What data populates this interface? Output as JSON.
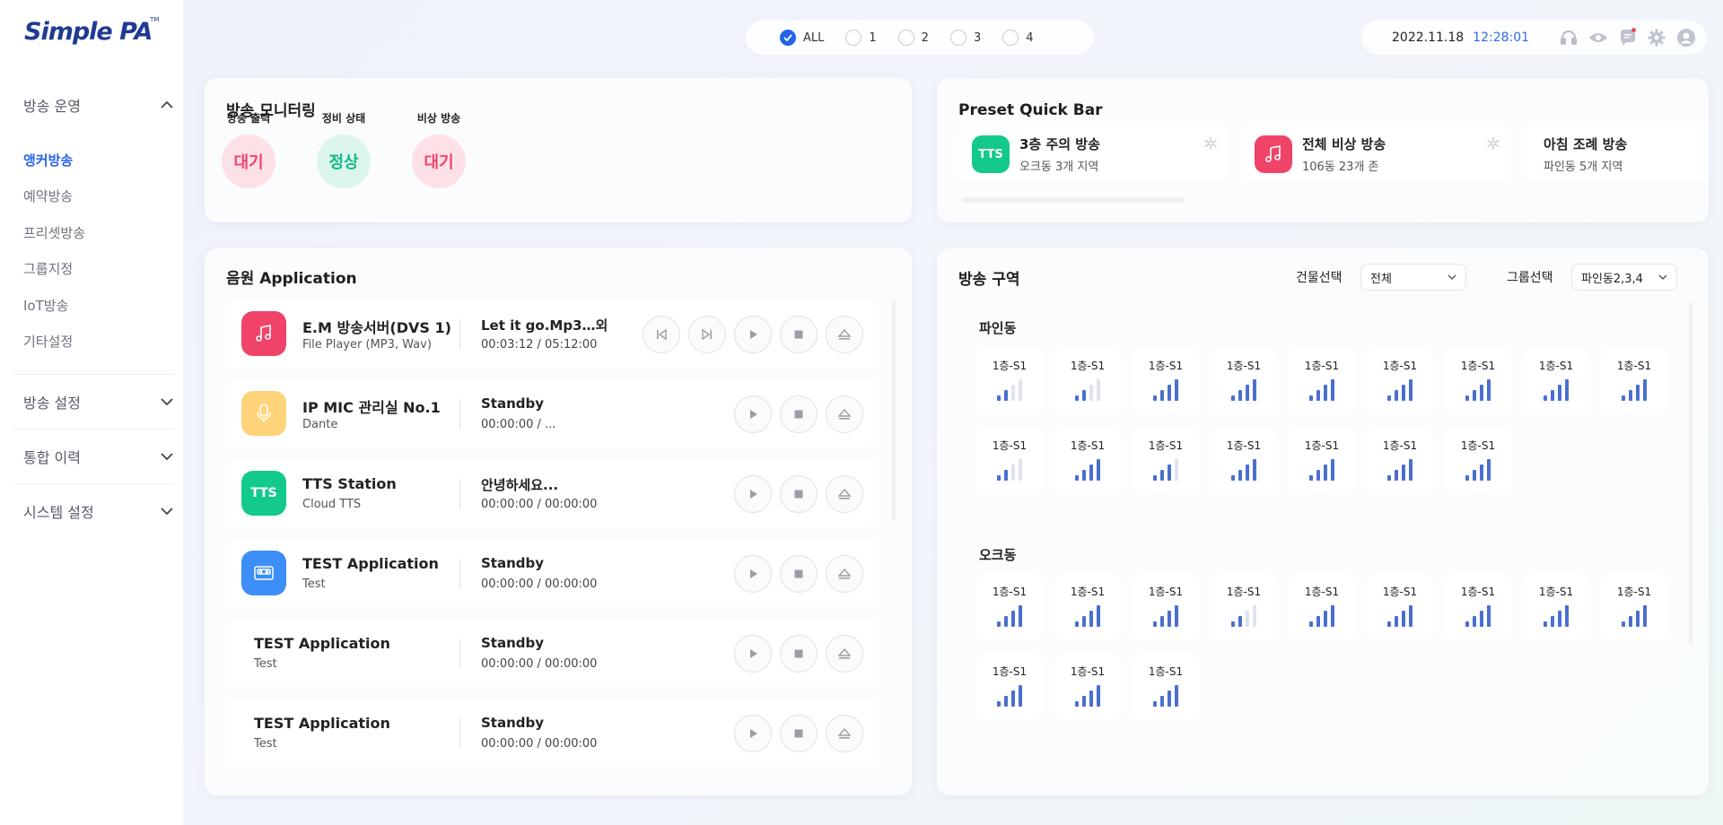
{
  "brand": {
    "logo_text": "Simple PA",
    "tm": "TM"
  },
  "sidebar": {
    "groups": [
      {
        "label": "방송 운영",
        "expanded": true,
        "items": [
          "앵커방송",
          "예약방송",
          "프리셋방송",
          "그룹지정",
          "IoT방송",
          "기타설정"
        ],
        "active_index": 0
      },
      {
        "label": "방송 설정",
        "expanded": false
      },
      {
        "label": "통합 이력",
        "expanded": false
      },
      {
        "label": "시스템 설정",
        "expanded": false
      }
    ]
  },
  "filters": {
    "options": [
      "ALL",
      "1",
      "2",
      "3",
      "4"
    ],
    "selected": "ALL"
  },
  "status": {
    "date": "2022.11.18",
    "time": "12:28:01",
    "icons": [
      "headset-icon",
      "eye-icon",
      "message-icon",
      "settings-icon",
      "user-icon"
    ]
  },
  "monitoring": {
    "title": "방송 모니터링",
    "items": [
      {
        "label": "방송 출력",
        "value": "대기",
        "color": "#f0436a",
        "bg": "#fde1e7"
      },
      {
        "label": "정비 상태",
        "value": "정상",
        "color": "#12b886",
        "bg": "#dcf6ec"
      },
      {
        "label": "비상 방송",
        "value": "대기",
        "color": "#f0436a",
        "bg": "#fde1e7"
      }
    ]
  },
  "preset": {
    "title": "Preset Quick Bar",
    "cards": [
      {
        "icon": "tts-icon",
        "icon_text": "TTS",
        "color": "#14c98c",
        "title": "3층 주의 방송",
        "sub": "오크동 3개 지역"
      },
      {
        "icon": "music-note-icon",
        "color": "#f0436a",
        "title": "전체 비상 방송",
        "sub": "106동 23개 존"
      },
      {
        "icon": "",
        "color": "",
        "title": "아침 조례 방송",
        "sub": "파인동 5개 지역"
      }
    ]
  },
  "audio": {
    "title": "음원 Application",
    "rows": [
      {
        "icon": "music-note-icon",
        "color": "#f0436a",
        "name": "E.M 방송서버(DVS 1)",
        "sub": "File Player (MP3, Wav)",
        "track": "Let it go.Mp3…외",
        "time": "00:03:12 / 05:12:00",
        "controls": [
          "prev",
          "next",
          "play",
          "stop",
          "eject"
        ]
      },
      {
        "icon": "microphone-icon",
        "color": "#ffd37a",
        "name": "IP MIC 관리실 No.1",
        "sub": "Dante",
        "track": "Standby",
        "time": "00:00:00 / ...",
        "controls": [
          "play",
          "stop",
          "eject"
        ]
      },
      {
        "icon": "tts-icon",
        "icon_text": "TTS",
        "color": "#14c98c",
        "name": "TTS Station",
        "sub": "Cloud TTS",
        "track": "안녕하세요...",
        "time": "00:00:00 / 00:00:00",
        "controls": [
          "play",
          "stop",
          "eject"
        ]
      },
      {
        "icon": "cassette-icon",
        "color": "#3d8ef7",
        "name": "TEST Application",
        "sub": "Test",
        "track": "Standby",
        "time": "00:00:00 / 00:00:00",
        "controls": [
          "play",
          "stop",
          "eject"
        ]
      },
      {
        "icon": "",
        "color": "",
        "name": "TEST Application",
        "sub": "Test",
        "track": "Standby",
        "time": "00:00:00 / 00:00:00",
        "controls": [
          "play",
          "stop",
          "eject"
        ]
      },
      {
        "icon": "",
        "color": "",
        "name": "TEST Application",
        "sub": "Test",
        "track": "Standby",
        "time": "00:00:00 / 00:00:00",
        "controls": [
          "play",
          "stop",
          "eject"
        ]
      }
    ]
  },
  "zones": {
    "title": "방송 구역",
    "building_label": "건물선택",
    "building_value": "전체",
    "group_label": "그룹선택",
    "group_value": "파인동2,3,4",
    "buildings": [
      {
        "name": "파인동",
        "tiles": [
          {
            "label": "1층-S1",
            "level": 2
          },
          {
            "label": "1층-S1",
            "level": 2
          },
          {
            "label": "1층-S1",
            "level": 4
          },
          {
            "label": "1층-S1",
            "level": 4
          },
          {
            "label": "1층-S1",
            "level": 4
          },
          {
            "label": "1층-S1",
            "level": 4
          },
          {
            "label": "1층-S1",
            "level": 4
          },
          {
            "label": "1층-S1",
            "level": 4
          },
          {
            "label": "1층-S1",
            "level": 4
          },
          {
            "label": "1층-S1",
            "level": 2
          },
          {
            "label": "1층-S1",
            "level": 4
          },
          {
            "label": "1층-S1",
            "level": 3
          },
          {
            "label": "1층-S1",
            "level": 4
          },
          {
            "label": "1층-S1",
            "level": 4
          },
          {
            "label": "1층-S1",
            "level": 4
          },
          {
            "label": "1층-S1",
            "level": 4
          }
        ]
      },
      {
        "name": "오크동",
        "tiles": [
          {
            "label": "1층-S1",
            "level": 4
          },
          {
            "label": "1층-S1",
            "level": 4
          },
          {
            "label": "1층-S1",
            "level": 4
          },
          {
            "label": "1층-S1",
            "level": 2
          },
          {
            "label": "1층-S1",
            "level": 4
          },
          {
            "label": "1층-S1",
            "level": 4
          },
          {
            "label": "1층-S1",
            "level": 4
          },
          {
            "label": "1층-S1",
            "level": 4
          },
          {
            "label": "1층-S1",
            "level": 4
          },
          {
            "label": "1층-S1",
            "level": 4
          },
          {
            "label": "1층-S1",
            "level": 4
          },
          {
            "label": "1층-S1",
            "level": 4
          }
        ]
      }
    ]
  },
  "colors": {
    "accent": "#2563eb",
    "bar_on": "#4a6fd0",
    "bar_off": "#dfe3ef"
  }
}
